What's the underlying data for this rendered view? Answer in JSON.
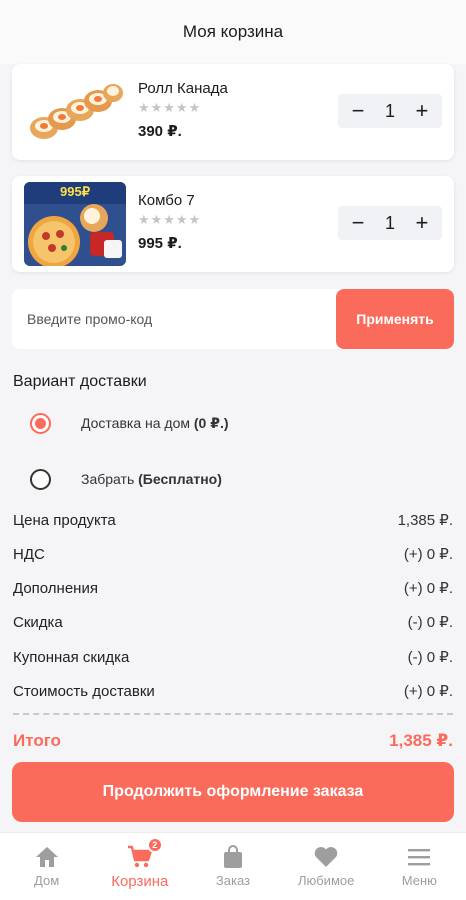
{
  "header": {
    "title": "Моя корзина"
  },
  "cart_items": [
    {
      "name": "Ролл Канада",
      "stars": "★★★★★",
      "price": "390 ₽.",
      "qty": "1"
    },
    {
      "name": "Комбо 7",
      "stars": "★★★★★",
      "price": "995 ₽.",
      "qty": "1",
      "image_text": "995₽"
    }
  ],
  "stepper": {
    "minus": "−",
    "plus": "+"
  },
  "promo": {
    "placeholder": "Введите промо-код",
    "value": "",
    "apply_label": "Применять"
  },
  "delivery": {
    "title": "Вариант доставки",
    "options": [
      {
        "label": "Доставка на дом",
        "extra": "(0 ₽.)",
        "selected": true
      },
      {
        "label": "Забрать",
        "extra": "(Бесплатно)",
        "selected": false
      }
    ]
  },
  "summary": [
    {
      "label": "Цена продукта",
      "value": "1,385 ₽."
    },
    {
      "label": "НДС",
      "value": "(+) 0 ₽."
    },
    {
      "label": "Дополнения",
      "value": "(+) 0 ₽."
    },
    {
      "label": "Скидка",
      "value": "(-) 0 ₽."
    },
    {
      "label": "Купонная скидка",
      "value": "(-) 0 ₽."
    },
    {
      "label": "Стоимость доставки",
      "value": "(+) 0 ₽."
    }
  ],
  "total": {
    "label": "Итого",
    "value": "1,385 ₽."
  },
  "checkout": {
    "label": "Продолжить оформление заказа"
  },
  "nav": [
    {
      "label": "Дом",
      "icon": "home-icon"
    },
    {
      "label": "Корзина",
      "icon": "cart-icon",
      "badge": "2",
      "active": true
    },
    {
      "label": "Заказ",
      "icon": "bag-icon"
    },
    {
      "label": "Любимое",
      "icon": "heart-icon"
    },
    {
      "label": "Меню",
      "icon": "menu-icon"
    }
  ],
  "colors": {
    "accent": "#fb6b5b",
    "background": "#f5f5f7",
    "inactive": "#9e9e9e"
  }
}
